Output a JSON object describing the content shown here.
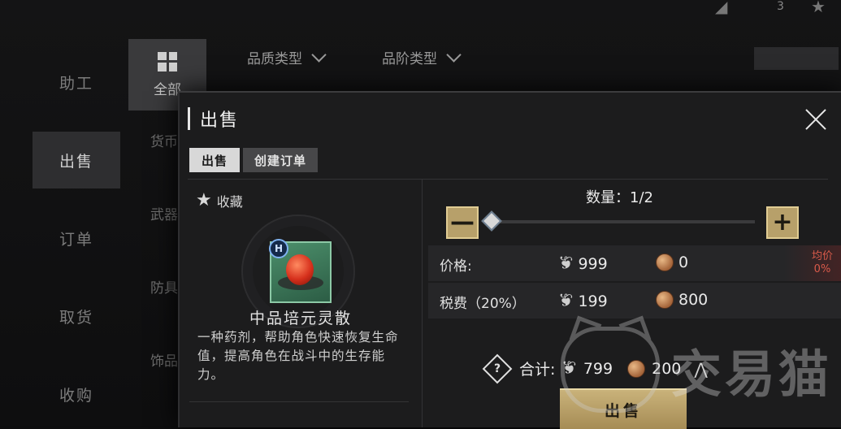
{
  "background": {
    "left_nav": [
      "助工",
      "出售",
      "订单",
      "取货",
      "收购"
    ],
    "category_all": "全部",
    "categories": [
      "货币",
      "武器",
      "防具",
      "饰品"
    ],
    "filters": [
      "品质类型",
      "品阶类型"
    ],
    "top_right_num": "3"
  },
  "dialog": {
    "title": "出售",
    "tabs": [
      "出售",
      "创建订单"
    ],
    "favorite_label": "收藏",
    "item": {
      "grade_badge": "H",
      "name": "中品培元灵散",
      "description": "一种药剂，帮助角色快速恢复生命值，提高角色在战斗中的生存能力。"
    },
    "quantity": {
      "label": "数量：",
      "value": "1/2",
      "fraction": 0.5,
      "minus": "—",
      "plus": "+"
    },
    "price": {
      "label": "价格:",
      "currency1": "999",
      "currency2": "0",
      "avg_label": "均价",
      "avg_value": "0%"
    },
    "tax": {
      "label": "税费（20%）",
      "currency1": "199",
      "currency2": "800"
    },
    "total": {
      "help": "?",
      "label": "合计:",
      "currency1": "799",
      "currency2": "200"
    },
    "sell_button": "出售"
  },
  "watermark": "交易猫",
  "icons": {
    "close": "close-icon",
    "star": "star-icon",
    "feather": "feather-currency-icon",
    "coin": "coin-currency-icon",
    "chart": "price-trend-icon"
  }
}
